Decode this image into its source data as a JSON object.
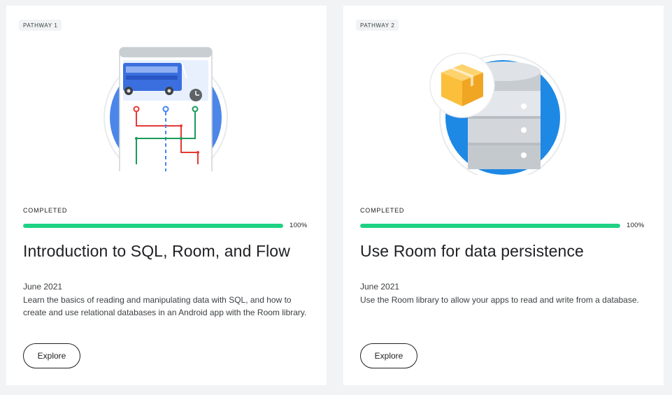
{
  "cards": [
    {
      "badge": "PATHWAY 1",
      "status": "COMPLETED",
      "progress_percent": 100,
      "progress_label": "100%",
      "title": "Introduction to SQL, Room, and Flow",
      "date": "June 2021",
      "description": "Learn the basics of reading and manipulating data with SQL, and how to create and use relational databases in an Android app with the Room library.",
      "button_label": "Explore",
      "illustration_icon": "bus-schedule-phone-icon"
    },
    {
      "badge": "PATHWAY 2",
      "status": "COMPLETED",
      "progress_percent": 100,
      "progress_label": "100%",
      "title": "Use Room for data persistence",
      "date": "June 2021",
      "description": "Use the Room library to allow your apps to read and write from a database.",
      "button_label": "Explore",
      "illustration_icon": "database-box-icon"
    }
  ],
  "colors": {
    "progress_fill": "#1ed183",
    "bus_blue": "#3b6fe0",
    "db_blue": "#1e88e5",
    "route_red": "#e53935",
    "route_green": "#1a9b5a",
    "box_yellow": "#fbbf3b"
  }
}
